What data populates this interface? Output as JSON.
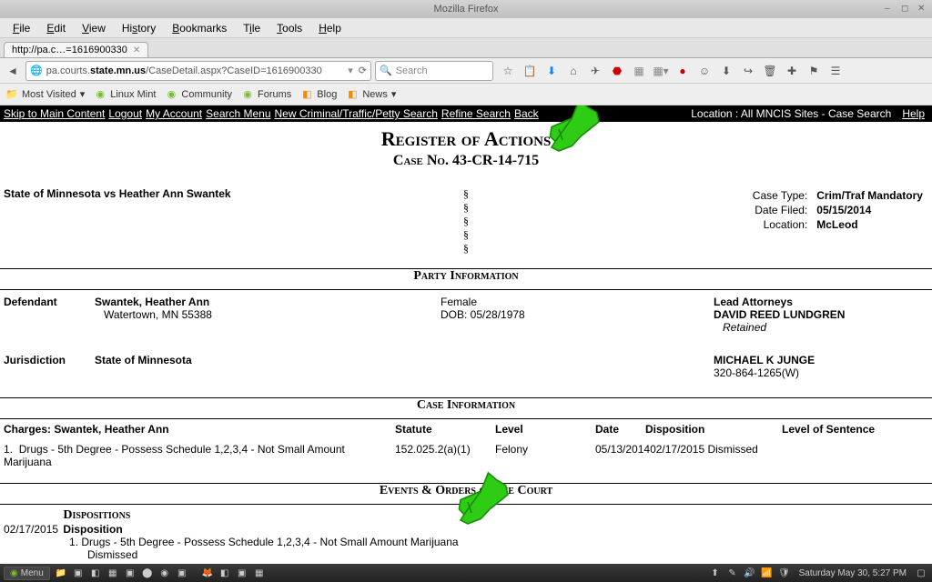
{
  "window": {
    "title": "Mozilla Firefox"
  },
  "menubar": [
    "File",
    "Edit",
    "View",
    "History",
    "Bookmarks",
    "Tile",
    "Tools",
    "Help"
  ],
  "tab": {
    "title": "http://pa.c…=1616900330"
  },
  "urlbar": {
    "prefix": "pa.courts.",
    "bold": "state.mn.us",
    "suffix": "/CaseDetail.aspx?CaseID=1616900330"
  },
  "searchbar": {
    "placeholder": "Search"
  },
  "bookmarks": [
    {
      "label": "Most Visited",
      "dropdown": true
    },
    {
      "label": "Linux Mint"
    },
    {
      "label": "Community"
    },
    {
      "label": "Forums"
    },
    {
      "label": "Blog"
    },
    {
      "label": "News",
      "dropdown": true
    }
  ],
  "blackbar": {
    "links": [
      "Skip to Main Content",
      "Logout",
      "My Account",
      "Search Menu",
      "New Criminal/Traffic/Petty Search",
      "Refine Search",
      "Back"
    ],
    "location_text": "Location : All MNCIS Sites - Case Search",
    "help": "Help"
  },
  "register_title": "Register of Actions",
  "case_no_label": "Case No.",
  "case_no": "43-CR-14-715",
  "case_title": "State of Minnesota vs Heather Ann Swantek",
  "case_meta": {
    "type_label": "Case Type:",
    "type": "Crim/Traf Mandatory",
    "filed_label": "Date Filed:",
    "filed": "05/15/2014",
    "loc_label": "Location:",
    "loc": "McLeod"
  },
  "sections": {
    "party": "Party Information",
    "case_info": "Case Information",
    "events": "Events & Orders of the Court"
  },
  "parties": {
    "defendant_label": "Defendant",
    "defendant_name": "Swantek, Heather Ann",
    "defendant_addr": "Watertown, MN 55388",
    "defendant_sex": "Female",
    "defendant_dob": "DOB: 05/28/1978",
    "jurisdiction_label": "Jurisdiction",
    "jurisdiction": "State of Minnesota",
    "lead_attorneys_label": "Lead Attorneys",
    "attorney1": "DAVID REED LUNDGREN",
    "attorney1_status": "Retained",
    "attorney2": "MICHAEL K JUNGE",
    "attorney2_phone": "320-864-1265(W)"
  },
  "charges": {
    "header_name": "Charges: Swantek, Heather Ann",
    "col_statute": "Statute",
    "col_level": "Level",
    "col_date": "Date",
    "col_dispo": "Disposition",
    "col_sentence": "Level of Sentence",
    "rows": [
      {
        "num": "1.",
        "desc": "Drugs - 5th Degree - Possess Schedule 1,2,3,4 - Not Small Amount Marijuana",
        "statute": "152.025.2(a)(1)",
        "level": "Felony",
        "date": "05/13/2014",
        "dispo_date": "02/17/2015",
        "dispo": "Dismissed",
        "sentence": ""
      }
    ]
  },
  "dispositions": {
    "heading": "Dispositions",
    "date": "02/17/2015",
    "label": "Disposition",
    "item_num": "1.",
    "item_desc": "Drugs - 5th Degree - Possess Schedule 1,2,3,4 - Not Small Amount Marijuana",
    "item_result": "Dismissed"
  },
  "taskbar": {
    "menu": "Menu",
    "clock": "Saturday May 30, 5:27 PM"
  }
}
